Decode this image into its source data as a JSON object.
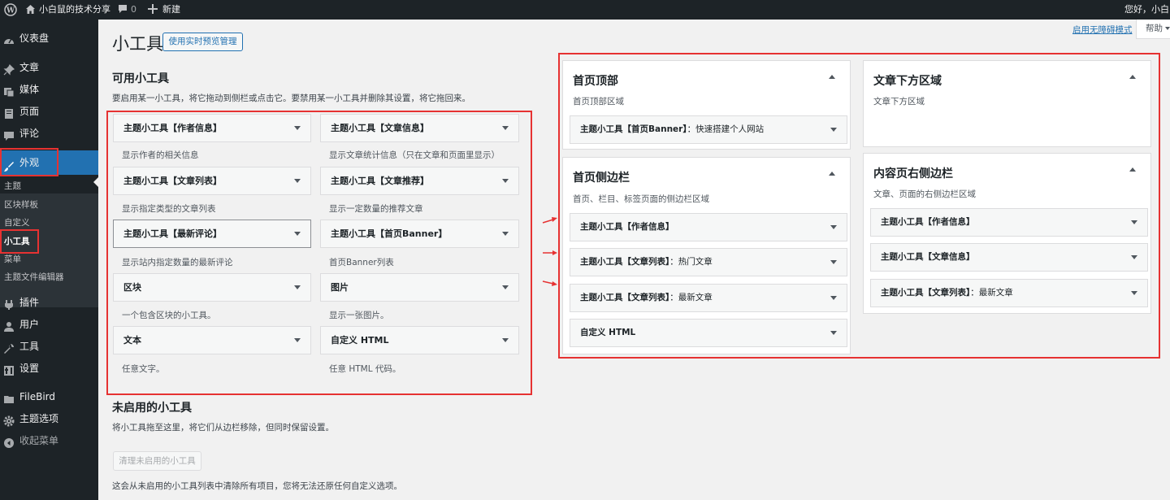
{
  "admin_bar": {
    "site_name": "小白鼠的技术分享",
    "comments_count": "0",
    "new_label": "新建",
    "greeting": "您好，小白鼠"
  },
  "sidebar": {
    "items": [
      {
        "label": "仪表盘",
        "icon": "dashboard-icon"
      },
      {
        "label": "文章",
        "icon": "pin-icon"
      },
      {
        "label": "媒体",
        "icon": "media-icon"
      },
      {
        "label": "页面",
        "icon": "page-icon"
      },
      {
        "label": "评论",
        "icon": "comment-icon"
      },
      {
        "label": "外观",
        "icon": "brush-icon"
      },
      {
        "label": "插件",
        "icon": "plugin-icon"
      },
      {
        "label": "用户",
        "icon": "user-icon"
      },
      {
        "label": "工具",
        "icon": "wrench-icon"
      },
      {
        "label": "设置",
        "icon": "settings-icon"
      },
      {
        "label": "FileBird",
        "icon": "folder-icon"
      },
      {
        "label": "主题选项",
        "icon": "gear-icon"
      },
      {
        "label": "收起菜单",
        "icon": "collapse-icon"
      }
    ],
    "submenu": [
      "主题",
      "区块样板",
      "自定义",
      "小工具",
      "菜单",
      "主题文件编辑器"
    ]
  },
  "screen_options": {
    "accessibility_link": "启用无障碍模式",
    "help_label": "帮助"
  },
  "page": {
    "title": "小工具",
    "live_preview_button": "使用实时预览管理"
  },
  "available": {
    "heading": "可用小工具",
    "description": "要启用某一小工具，将它拖动到侧栏或点击它。要禁用某一小工具并删除其设置，将它拖回来。",
    "widgets": [
      {
        "title": "主题小工具【作者信息】",
        "desc": "显示作者的相关信息"
      },
      {
        "title": "主题小工具【文章信息】",
        "desc": "显示文章统计信息（只在文章和页面里显示）"
      },
      {
        "title": "主题小工具【文章列表】",
        "desc": "显示指定类型的文章列表"
      },
      {
        "title": "主题小工具【文章推荐】",
        "desc": "显示一定数量的推荐文章"
      },
      {
        "title": "主题小工具【最新评论】",
        "desc": "显示站内指定数量的最新评论"
      },
      {
        "title": "主题小工具【首页Banner】",
        "desc": "首页Banner列表"
      },
      {
        "title": "区块",
        "desc": "一个包含区块的小工具。"
      },
      {
        "title": "图片",
        "desc": "显示一张图片。"
      },
      {
        "title": "文本",
        "desc": "任意文字。"
      },
      {
        "title": "自定义 HTML",
        "desc": "任意 HTML 代码。"
      }
    ]
  },
  "inactive": {
    "heading": "未启用的小工具",
    "description": "将小工具拖至这里，将它们从边栏移除，但同时保留设置。",
    "clear_button": "清理未启用的小工具",
    "note": "这会从未启用的小工具列表中清除所有项目，您将无法还原任何自定义选项。"
  },
  "sidebars": [
    {
      "title": "首页顶部",
      "desc": "首页顶部区域",
      "items": [
        {
          "name": "主题小工具【首页Banner】",
          "sub": "：快速搭建个人网站"
        }
      ]
    },
    {
      "title": "首页侧边栏",
      "desc": "首页、栏目、标签页面的侧边栏区域",
      "items": [
        {
          "name": "主题小工具【作者信息】",
          "sub": ""
        },
        {
          "name": "主题小工具【文章列表】",
          "sub": "：热门文章"
        },
        {
          "name": "主题小工具【文章列表】",
          "sub": "：最新文章"
        },
        {
          "name": "自定义 HTML",
          "sub": ""
        }
      ]
    },
    {
      "title": "文章下方区域",
      "desc": "文章下方区域",
      "items": []
    },
    {
      "title": "内容页右侧边栏",
      "desc": "文章、页面的右侧边栏区域",
      "items": [
        {
          "name": "主题小工具【作者信息】",
          "sub": ""
        },
        {
          "name": "主题小工具【文章信息】",
          "sub": ""
        },
        {
          "name": "主题小工具【文章列表】",
          "sub": "：最新文章"
        }
      ]
    }
  ],
  "colors": {
    "admin_dark": "#1d2327",
    "accent_blue": "#2271b1",
    "highlight_red": "#e63232"
  }
}
